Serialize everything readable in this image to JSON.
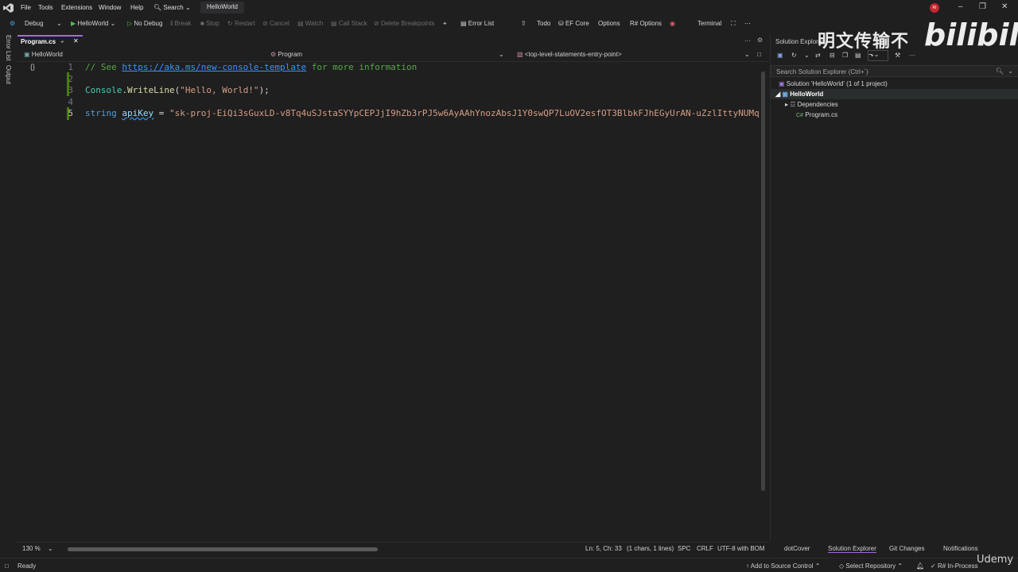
{
  "menubar": {
    "items": [
      "File",
      "Tools",
      "Extensions",
      "Window",
      "Help",
      "Search"
    ],
    "solution_name": "HelloWorld",
    "avatar_initials": "RI"
  },
  "toolbar": {
    "config": "Debug",
    "run_target": "HelloWorld",
    "no_debug": "No Debug",
    "break": "Break",
    "stop": "Stop",
    "restart": "Restart",
    "cancel": "Cancel",
    "watch": "Watch",
    "call_stack": "Call Stack",
    "delete_breakpoints": "Delete Breakpoints",
    "error_list": "Error List",
    "todo": "Todo",
    "ef_core": "EF Core",
    "options": "Options",
    "rs_options": "R# Options",
    "terminal": "Terminal"
  },
  "left_strip": {
    "error_list": "Error List",
    "output": "Output"
  },
  "editor": {
    "tab_label": "Program.cs",
    "nav_project": "HelloWorld",
    "nav_class": "Program",
    "nav_member": "<top-level-statements-entry-point>",
    "line_numbers": [
      "1",
      "2",
      "3",
      "4",
      "5"
    ],
    "code": {
      "l1_comment_a": "// See ",
      "l1_link": "https://aka.ms/new-console-template",
      "l1_comment_b": " for more information",
      "l3_class": "Console",
      "l3_dot": ".",
      "l3_method": "WriteLine",
      "l3_open": "(",
      "l3_string": "\"Hello, World!\"",
      "l3_close": ");",
      "l5_kw": "string",
      "l5_var": "apiKey",
      "l5_eq": " = ",
      "l5_string": "\"sk-proj-EiQi3sGuxLD-v8Tq4uSJstaSYYpCEPJjI9hZb3rPJ5w6AyAAhYnozAbsJ1Y0swQP7LuOV2esfOT3BlbkFJhEGyUrAN-uZzlIttyNUMq"
    }
  },
  "editor_status": {
    "zoom": "130 %",
    "position": "Ln: 5, Ch: 33",
    "selection": "(1 chars, 1 lines)",
    "spc": "SPC",
    "crlf": "CRLF",
    "encoding": "UTF-8 with BOM"
  },
  "solution_explorer": {
    "title": "Solution Explorer",
    "search_placeholder": "Search Solution Explorer (Ctrl+`)",
    "tree": {
      "solution": "Solution 'HelloWorld' (1 of 1 project)",
      "project": "HelloWorld",
      "dependencies": "Dependencies",
      "file": "Program.cs"
    },
    "bottom_tabs": [
      "dotCover",
      "Solution Explorer",
      "Git Changes",
      "Notifications"
    ]
  },
  "watermark": {
    "chinese": "明文传输不",
    "bili": "bilibili",
    "udemy": "Udemy"
  },
  "statusbar": {
    "ready": "Ready",
    "source_control": "Add to Source Control",
    "repository": "Select Repository",
    "rs_status": "R# In-Process"
  },
  "colors": {
    "background": "#1f1f1f",
    "accent_purple": "#9f6ad8",
    "comment_green": "#57a64a",
    "string_brown": "#d69d85",
    "keyword_blue": "#569cd6",
    "class_teal": "#4ec9b0"
  }
}
